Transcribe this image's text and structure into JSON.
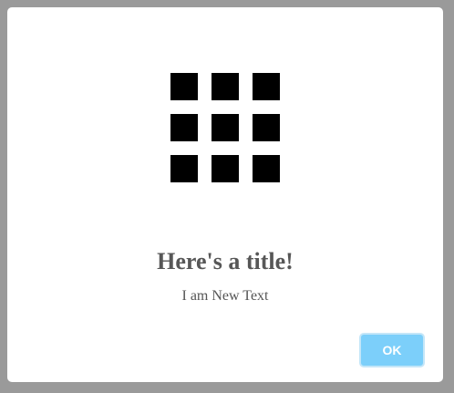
{
  "dialog": {
    "icon": "grid-icon",
    "title": "Here's a title!",
    "text": "I am New Text",
    "ok_label": "OK"
  },
  "colors": {
    "overlay": "#9a9a9a",
    "dialog_background": "#ffffff",
    "title": "#575757",
    "text": "#555555",
    "button": "#7ccffa",
    "button_text": "#ffffff",
    "icon": "#000000"
  }
}
